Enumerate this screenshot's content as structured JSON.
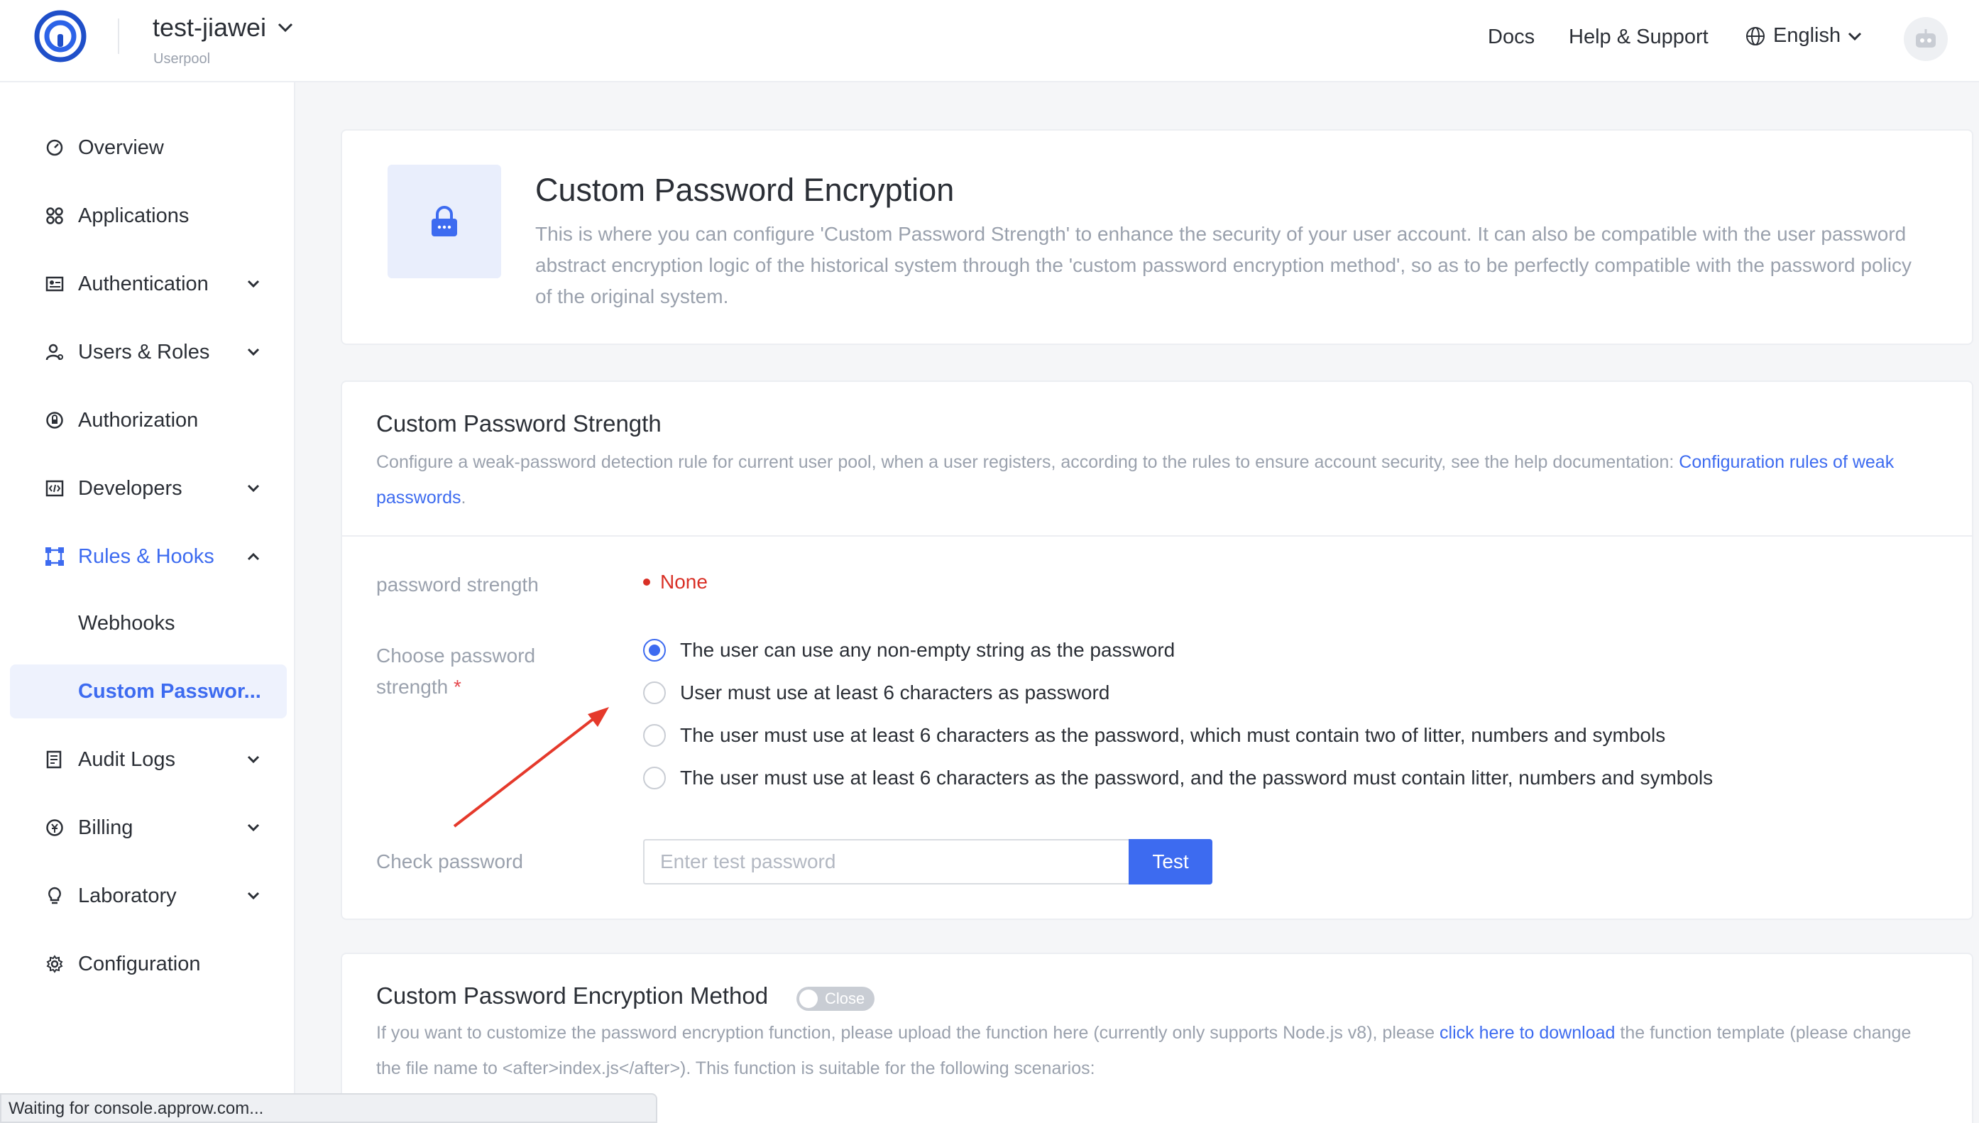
{
  "header": {
    "pool_name": "test-jiawei",
    "pool_sub": "Userpool",
    "links": [
      "Docs",
      "Help & Support"
    ],
    "language": "English"
  },
  "sidebar": {
    "items": [
      {
        "label": "Overview",
        "icon": "dashboard-icon"
      },
      {
        "label": "Applications",
        "icon": "apps-icon"
      },
      {
        "label": "Authentication",
        "icon": "id-card-icon"
      },
      {
        "label": "Users & Roles",
        "icon": "user-icon"
      },
      {
        "label": "Authorization",
        "icon": "lock-circle-icon"
      },
      {
        "label": "Developers",
        "icon": "code-icon"
      },
      {
        "label": "Rules & Hooks",
        "icon": "hooks-icon"
      },
      {
        "label": "Webhooks",
        "icon": ""
      },
      {
        "label": "Custom Passwor...",
        "icon": ""
      },
      {
        "label": "Audit Logs",
        "icon": "log-icon"
      },
      {
        "label": "Billing",
        "icon": "billing-icon"
      },
      {
        "label": "Laboratory",
        "icon": "bulb-icon"
      },
      {
        "label": "Configuration",
        "icon": "gear-icon"
      }
    ]
  },
  "hero": {
    "title": "Custom Password Encryption",
    "description": "This is where you can configure 'Custom Password Strength' to enhance the security of your user account. It can also be compatible with the user password abstract encryption logic of the historical system through the 'custom password encryption method', so as to be perfectly compatible with the password policy of the original system."
  },
  "strength": {
    "title": "Custom Password Strength",
    "desc_prefix": "Configure a weak-password detection rule for current user pool, when a user registers, according to the rules to ensure account security, see the help documentation: ",
    "desc_link": "Configuration rules of weak passwords",
    "desc_suffix": ".",
    "strength_label": "password strength",
    "strength_value": "None",
    "choose_label_1": "Choose password",
    "choose_label_2": "strength",
    "required_mark": "*",
    "options": [
      "The user can use any non-empty string as the password",
      "User must use at least 6 characters as password",
      "The user must use at least 6 characters as the password, which must contain two of litter, numbers and symbols",
      "The user must use at least 6 characters as the password, and the password must contain litter, numbers and symbols"
    ],
    "selected_index": 0,
    "check_label": "Check password",
    "check_placeholder": "Enter test password",
    "test_button": "Test"
  },
  "method": {
    "title": "Custom Password Encryption Method",
    "toggle_label": "Close",
    "desc_prefix": "If you want to customize the password encryption function, please upload the function here (currently only supports Node.js v8), please ",
    "desc_link": "click here to download",
    "desc_suffix": " the function template (please change the file name to <after>index.js</after>). This function is suitable for the following scenarios:"
  },
  "statusbar": "Waiting for console.approw.com...",
  "colors": {
    "accent": "#3d6bf0",
    "danger": "#d93026",
    "arrow": "#e5392b"
  }
}
